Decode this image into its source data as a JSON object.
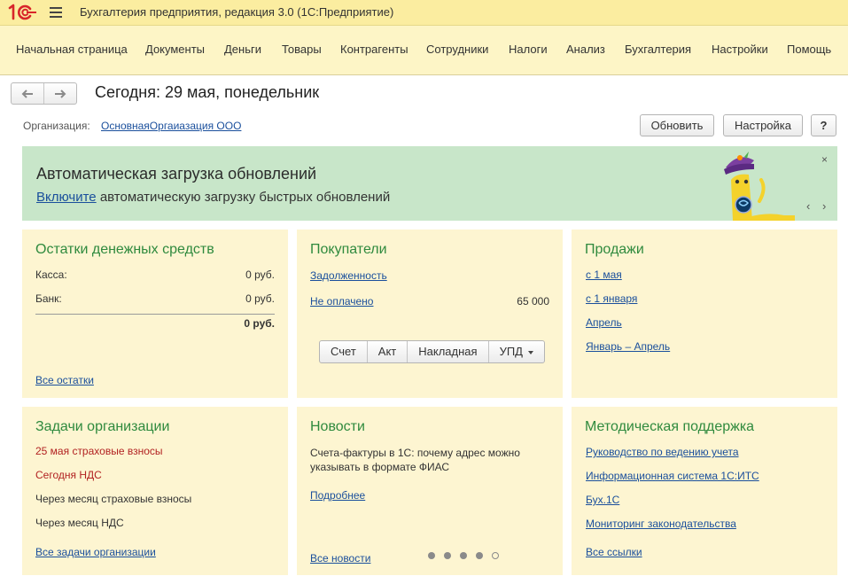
{
  "window": {
    "title": "Бухгалтерия предприятия, редакция 3.0  (1С:Предприятие)",
    "logo_text": "1С"
  },
  "menu": [
    "Начальная страница",
    "Документы",
    "Деньги",
    "Товары",
    "Контрагенты",
    "Сотрудники",
    "Налоги",
    "Анализ",
    "Бухгалтерия",
    "Настройки",
    "Помощь"
  ],
  "nav": {
    "back_icon": "arrow-left-icon",
    "forward_icon": "arrow-right-icon",
    "page_title": "Сегодня: 29 мая, понедельник"
  },
  "org": {
    "label": "Организация:",
    "value": "ОсновнаяОргаиазация ООО"
  },
  "buttons": {
    "refresh": "Обновить",
    "settings": "Настройка",
    "help": "?"
  },
  "banner": {
    "title": "Автоматическая загрузка обновлений",
    "link": "Включите",
    "text": " автоматическую загрузку быстрых обновлений",
    "close": "×",
    "prev": "‹",
    "next": "›"
  },
  "panels": {
    "money": {
      "title": "Остатки денежных средств",
      "rows": [
        {
          "label": "Касса:",
          "value": "0 руб."
        },
        {
          "label": "Банк:",
          "value": "0 руб."
        }
      ],
      "total": "0 руб.",
      "link": "Все остатки"
    },
    "buyers": {
      "title": "Покупатели",
      "debt_link": "Задолженность",
      "unpaid_link": "Не оплачено",
      "unpaid_value": "65 000",
      "doc_buttons": [
        "Счет",
        "Акт",
        "Накладная",
        "УПД"
      ]
    },
    "sales": {
      "title": "Продажи",
      "links": [
        "с 1 мая",
        "с 1 января",
        "Апрель",
        "Январь – Апрель"
      ]
    },
    "tasks": {
      "title": "Задачи организации",
      "items": [
        {
          "text": "25 мая страховые взносы",
          "urgent": true
        },
        {
          "text": "Сегодня НДС",
          "urgent": true
        },
        {
          "text": "Через месяц страховые взносы",
          "urgent": false
        },
        {
          "text": "Через месяц НДС",
          "urgent": false
        }
      ],
      "link": "Все задачи организации"
    },
    "news": {
      "title": "Новости",
      "text": "Счета-фактуры в 1С: почему адрес можно указывать в формате ФИАС",
      "more": "Подробнее",
      "all": "Все новости",
      "pages": 5,
      "current_page": 5
    },
    "support": {
      "title": "Методическая поддержка",
      "links": [
        "Руководство по ведению учета",
        "Информационная система 1С:ИТС",
        "Бух.1С",
        "Мониторинг законодательства"
      ],
      "all": "Все ссылки"
    }
  },
  "colors": {
    "titlebar": "#fbeda0",
    "menubar": "#fdf5c6",
    "banner": "#c8e6c9",
    "panel": "#fdf5d1",
    "panel_title": "#2f8a3e",
    "link": "#1a4f9c",
    "urgent": "#b22222",
    "logo": "#d8262a"
  }
}
